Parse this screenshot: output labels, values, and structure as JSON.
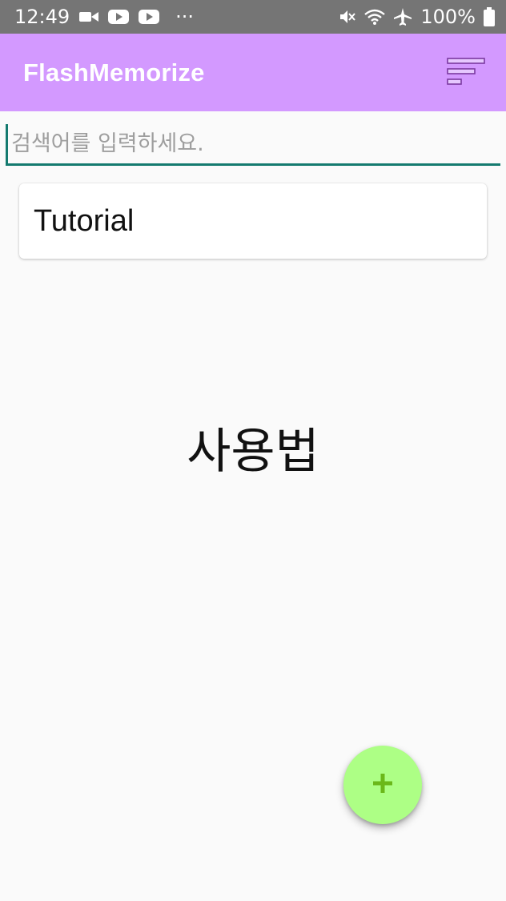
{
  "status_bar": {
    "time": "12:49",
    "dots": "···",
    "battery": "100%",
    "icons": [
      "video-camera-icon",
      "youtube-icon",
      "youtube-icon",
      "mute-icon",
      "wifi-icon",
      "airplane-icon",
      "battery-icon"
    ]
  },
  "app_bar": {
    "title": "FlashMemorize",
    "background": "#d399ff",
    "sort_icon": "sort-icon"
  },
  "search": {
    "placeholder": "검색어를 입력하세요.",
    "value": "",
    "underline_color": "#147a6f"
  },
  "deck_list": [
    {
      "title": "Tutorial"
    }
  ],
  "main": {
    "center_text": "사용법"
  },
  "fab": {
    "icon": "plus-icon",
    "background": "#adff85",
    "icon_color": "#6bb81a"
  }
}
